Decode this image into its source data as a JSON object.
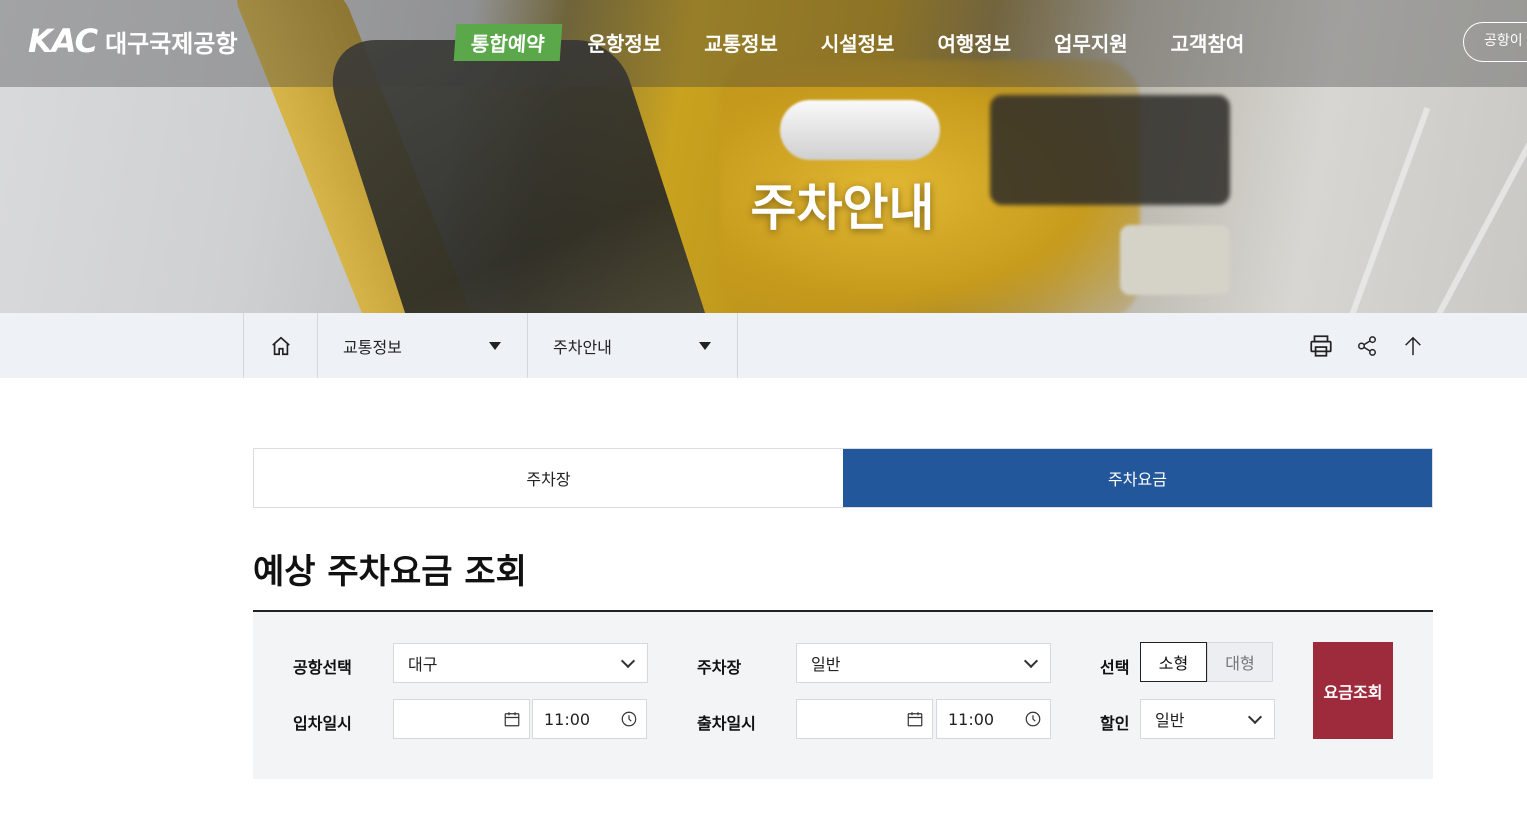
{
  "header": {
    "logo_mark": "KAC",
    "logo_text": "대구국제공항",
    "nav": [
      "통합예약",
      "운항정보",
      "교통정보",
      "시설정보",
      "여행정보",
      "업무지원",
      "고객참여"
    ],
    "util_button": "공항이"
  },
  "hero": {
    "title": "주차안내"
  },
  "breadcrumb": {
    "level1": "교통정보",
    "level2": "주차안내"
  },
  "tabs": [
    "주차장",
    "주차요금"
  ],
  "section_title": "예상 주차요금 조회",
  "form": {
    "airport_label": "공항선택",
    "airport_value": "대구",
    "parking_label": "주차장",
    "parking_value": "일반",
    "select_label": "선택",
    "size_small": "소형",
    "size_large": "대형",
    "entry_label": "입차일시",
    "entry_date": "",
    "entry_time": "11:00",
    "exit_label": "출차일시",
    "exit_date": "",
    "exit_time": "11:00",
    "discount_label": "할인",
    "discount_value": "일반",
    "search_button": "요금조회"
  },
  "colors": {
    "active_nav": "#5aa84a",
    "active_tab": "#23579b",
    "search_button": "#9e2b3c"
  }
}
